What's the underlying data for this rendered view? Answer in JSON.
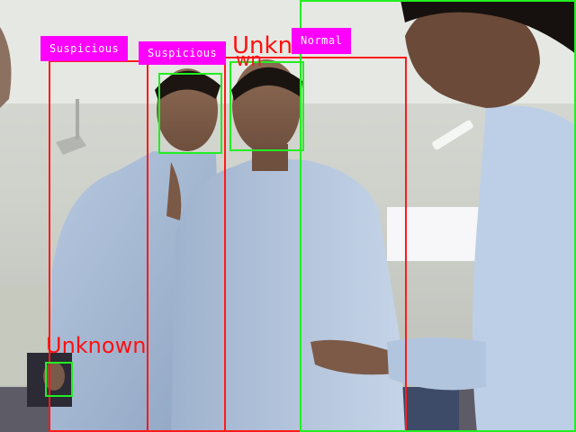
{
  "colors": {
    "suspicious_box": "#ff1a1a",
    "normal_box": "#22ee22",
    "face_box": "#22ee22",
    "label_bg": "#ff00ff",
    "label_text": "#ffffff",
    "unknown_text": "#ff1010"
  },
  "detections": [
    {
      "status": "Suspicious",
      "box_color": "red"
    },
    {
      "status": "Suspicious",
      "box_color": "red"
    },
    {
      "status": "Normal",
      "box_color": "green"
    }
  ],
  "face_labels": [
    {
      "text": "Unknown",
      "shown": "Unkn"
    },
    {
      "text": "Unknown",
      "shown": "Unknown"
    }
  ],
  "overlay_text": {
    "top_unknown": "Unkn",
    "top_unknown_tail": "wn",
    "bottom_unknown": "Unknown"
  }
}
